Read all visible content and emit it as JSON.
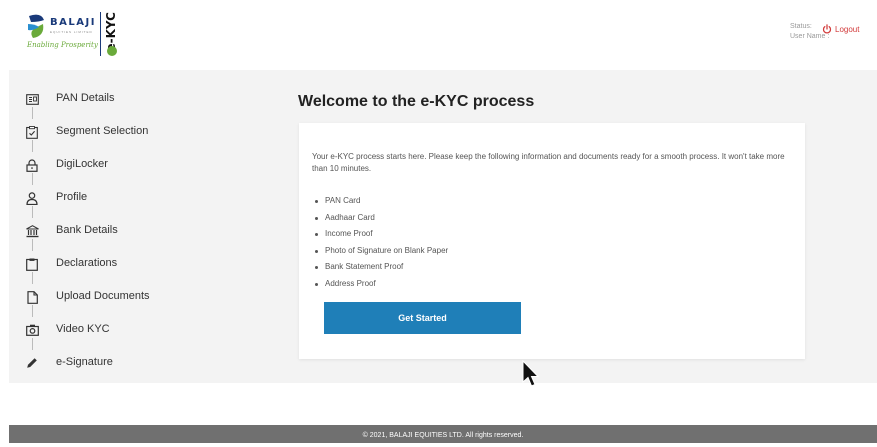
{
  "header": {
    "brand": "BALAJI",
    "brand_sub": "EQUITIES LIMITED",
    "tagline": "Enabling Prosperity",
    "product": "e-KYC",
    "status_label": "Status:",
    "user_name_label": "User Name :",
    "logout_label": "Logout"
  },
  "sidebar": {
    "steps": [
      {
        "label": "PAN Details",
        "icon": "id-card-icon"
      },
      {
        "label": "Segment Selection",
        "icon": "clipboard-check-icon"
      },
      {
        "label": "DigiLocker",
        "icon": "lock-icon"
      },
      {
        "label": "Profile",
        "icon": "user-icon"
      },
      {
        "label": "Bank Details",
        "icon": "bank-icon"
      },
      {
        "label": "Declarations",
        "icon": "clipboard-icon"
      },
      {
        "label": "Upload Documents",
        "icon": "document-icon"
      },
      {
        "label": "Video KYC",
        "icon": "camera-icon"
      },
      {
        "label": "e-Signature",
        "icon": "pen-icon"
      }
    ]
  },
  "main": {
    "title": "Welcome to the e-KYC process",
    "intro": "Your e-KYC process starts here. Please keep the following information and documents ready for a smooth process. It won't take more than 10 minutes.",
    "documents": [
      "PAN Card",
      "Aadhaar Card",
      "Income Proof",
      "Photo of Signature on Blank Paper",
      "Bank Statement Proof",
      "Address Proof"
    ],
    "cta_label": "Get Started"
  },
  "footer": {
    "copyright": "© 2021, BALAJI EQUITIES LTD. All rights reserved."
  },
  "colors": {
    "accent": "#1f7fb8",
    "logout": "#d23a3a",
    "band": "#f3f3f3",
    "footer": "#707070"
  }
}
